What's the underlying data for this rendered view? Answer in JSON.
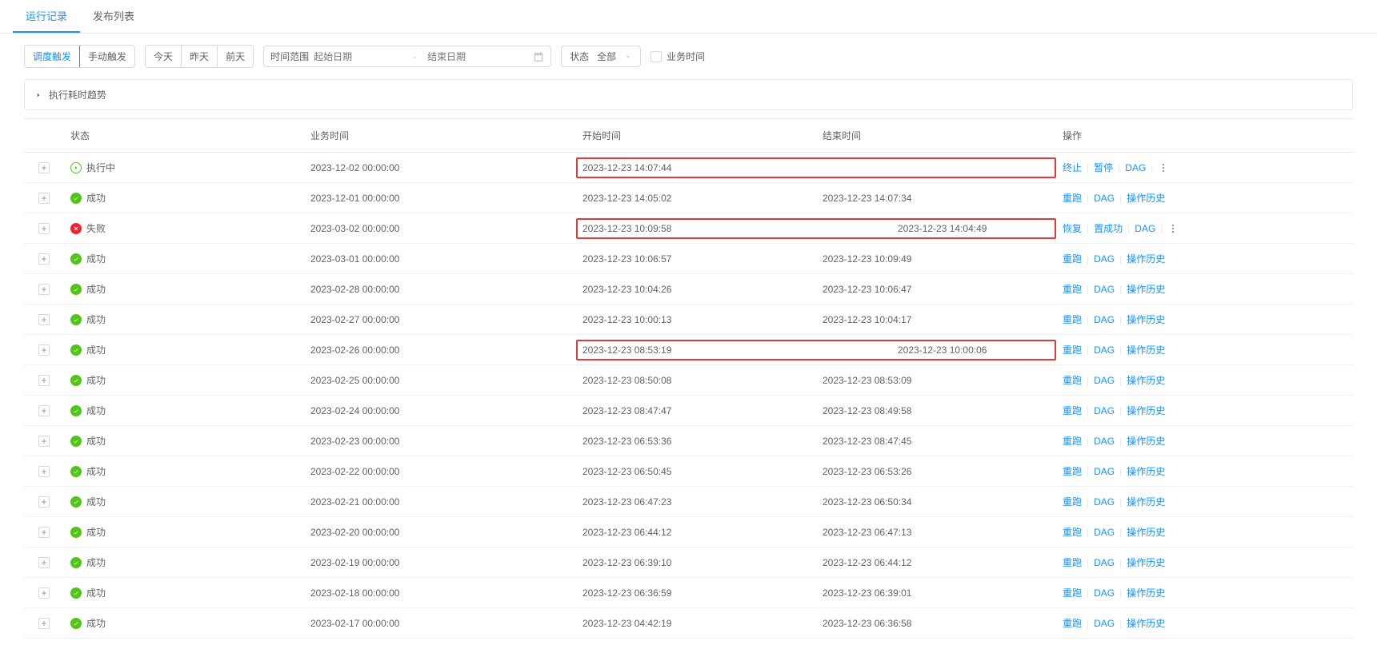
{
  "tabs": {
    "run": "运行记录",
    "publish": "发布列表"
  },
  "toolbar": {
    "trigger_schedule": "调度触发",
    "trigger_manual": "手动触发",
    "today": "今天",
    "yesterday": "昨天",
    "before": "前天",
    "time_range_label": "时间范围",
    "start_placeholder": "起始日期",
    "end_placeholder": "结束日期",
    "status_label": "状态",
    "status_value": "全部",
    "biz_time_chk": "业务时间"
  },
  "trend_label": "执行耗时趋势",
  "cols": {
    "status": "状态",
    "biz": "业务时间",
    "start": "开始时间",
    "end": "结束时间",
    "act": "操作"
  },
  "status_txt": {
    "running": "执行中",
    "success": "成功",
    "fail": "失败"
  },
  "act": {
    "stop": "终止",
    "pause": "暂停",
    "dag": "DAG",
    "rerun": "重跑",
    "history": "操作历史",
    "recover": "恢复",
    "setok": "置成功"
  },
  "rows": [
    {
      "type": "running",
      "biz": "2023-12-02 00:00:00",
      "start": "2023-12-23 14:07:44",
      "end": "",
      "hl": true,
      "acts": [
        "stop",
        "pause",
        "dag"
      ],
      "more": true
    },
    {
      "type": "success",
      "biz": "2023-12-01 00:00:00",
      "start": "2023-12-23 14:05:02",
      "end": "2023-12-23 14:07:34",
      "hl": false,
      "acts": [
        "rerun",
        "dag",
        "history"
      ],
      "more": false
    },
    {
      "type": "fail",
      "biz": "2023-03-02 00:00:00",
      "start": "2023-12-23 10:09:58",
      "end": "2023-12-23 14:04:49",
      "hl": true,
      "acts": [
        "recover",
        "setok",
        "dag"
      ],
      "more": true
    },
    {
      "type": "success",
      "biz": "2023-03-01 00:00:00",
      "start": "2023-12-23 10:06:57",
      "end": "2023-12-23 10:09:49",
      "hl": false,
      "acts": [
        "rerun",
        "dag",
        "history"
      ],
      "more": false
    },
    {
      "type": "success",
      "biz": "2023-02-28 00:00:00",
      "start": "2023-12-23 10:04:26",
      "end": "2023-12-23 10:06:47",
      "hl": false,
      "acts": [
        "rerun",
        "dag",
        "history"
      ],
      "more": false
    },
    {
      "type": "success",
      "biz": "2023-02-27 00:00:00",
      "start": "2023-12-23 10:00:13",
      "end": "2023-12-23 10:04:17",
      "hl": false,
      "acts": [
        "rerun",
        "dag",
        "history"
      ],
      "more": false
    },
    {
      "type": "success",
      "biz": "2023-02-26 00:00:00",
      "start": "2023-12-23 08:53:19",
      "end": "2023-12-23 10:00:06",
      "hl": true,
      "acts": [
        "rerun",
        "dag",
        "history"
      ],
      "more": false
    },
    {
      "type": "success",
      "biz": "2023-02-25 00:00:00",
      "start": "2023-12-23 08:50:08",
      "end": "2023-12-23 08:53:09",
      "hl": false,
      "acts": [
        "rerun",
        "dag",
        "history"
      ],
      "more": false
    },
    {
      "type": "success",
      "biz": "2023-02-24 00:00:00",
      "start": "2023-12-23 08:47:47",
      "end": "2023-12-23 08:49:58",
      "hl": false,
      "acts": [
        "rerun",
        "dag",
        "history"
      ],
      "more": false
    },
    {
      "type": "success",
      "biz": "2023-02-23 00:00:00",
      "start": "2023-12-23 06:53:36",
      "end": "2023-12-23 08:47:45",
      "hl": false,
      "acts": [
        "rerun",
        "dag",
        "history"
      ],
      "more": false
    },
    {
      "type": "success",
      "biz": "2023-02-22 00:00:00",
      "start": "2023-12-23 06:50:45",
      "end": "2023-12-23 06:53:26",
      "hl": false,
      "acts": [
        "rerun",
        "dag",
        "history"
      ],
      "more": false
    },
    {
      "type": "success",
      "biz": "2023-02-21 00:00:00",
      "start": "2023-12-23 06:47:23",
      "end": "2023-12-23 06:50:34",
      "hl": false,
      "acts": [
        "rerun",
        "dag",
        "history"
      ],
      "more": false
    },
    {
      "type": "success",
      "biz": "2023-02-20 00:00:00",
      "start": "2023-12-23 06:44:12",
      "end": "2023-12-23 06:47:13",
      "hl": false,
      "acts": [
        "rerun",
        "dag",
        "history"
      ],
      "more": false
    },
    {
      "type": "success",
      "biz": "2023-02-19 00:00:00",
      "start": "2023-12-23 06:39:10",
      "end": "2023-12-23 06:44:12",
      "hl": false,
      "acts": [
        "rerun",
        "dag",
        "history"
      ],
      "more": false
    },
    {
      "type": "success",
      "biz": "2023-02-18 00:00:00",
      "start": "2023-12-23 06:36:59",
      "end": "2023-12-23 06:39:01",
      "hl": false,
      "acts": [
        "rerun",
        "dag",
        "history"
      ],
      "more": false
    },
    {
      "type": "success",
      "biz": "2023-02-17 00:00:00",
      "start": "2023-12-23 04:42:19",
      "end": "2023-12-23 06:36:58",
      "hl": false,
      "acts": [
        "rerun",
        "dag",
        "history"
      ],
      "more": false
    }
  ]
}
